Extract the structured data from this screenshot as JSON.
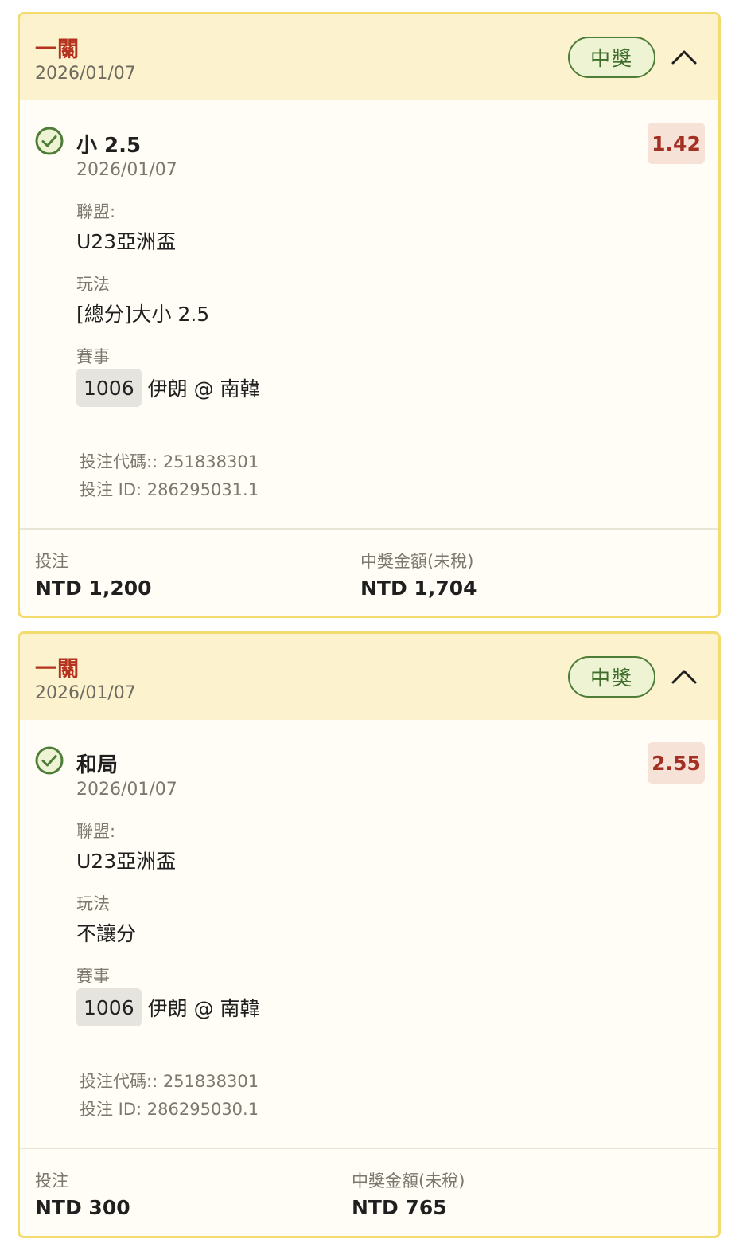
{
  "colors": {
    "card_border": "#f2dc6e",
    "header_bg": "#fcf2cd",
    "title_red": "#b5321f",
    "win_green": "#4d7d36",
    "odds_bg": "#f7e2d8"
  },
  "bets": [
    {
      "type_label": "一關",
      "date": "2026/01/07",
      "status": "中獎",
      "toggle_icon": "chevron-up-icon",
      "selection": "小 2.5",
      "selection_date": "2026/01/07",
      "odds": "1.42",
      "league_label": "聯盟:",
      "league": "U23亞洲盃",
      "play_label": "玩法",
      "play": "[總分]大小 2.5",
      "event_label": "賽事",
      "match_no": "1006",
      "match": "伊朗 @ 南韓",
      "bet_code": "投注代碼:: 251838301",
      "bet_id": "投注 ID: 286295031.1",
      "stake_label": "投注",
      "stake": "NTD 1,200",
      "payout_label": "中獎金額(未稅)",
      "payout": "NTD 1,704"
    },
    {
      "type_label": "一關",
      "date": "2026/01/07",
      "status": "中獎",
      "toggle_icon": "chevron-up-icon",
      "selection": "和局",
      "selection_date": "2026/01/07",
      "odds": "2.55",
      "league_label": "聯盟:",
      "league": "U23亞洲盃",
      "play_label": "玩法",
      "play": "不讓分",
      "event_label": "賽事",
      "match_no": "1006",
      "match": "伊朗 @ 南韓",
      "bet_code": "投注代碼:: 251838301",
      "bet_id": "投注 ID: 286295030.1",
      "stake_label": "投注",
      "stake": "NTD 300",
      "payout_label": "中獎金額(未稅)",
      "payout": "NTD 765"
    }
  ]
}
